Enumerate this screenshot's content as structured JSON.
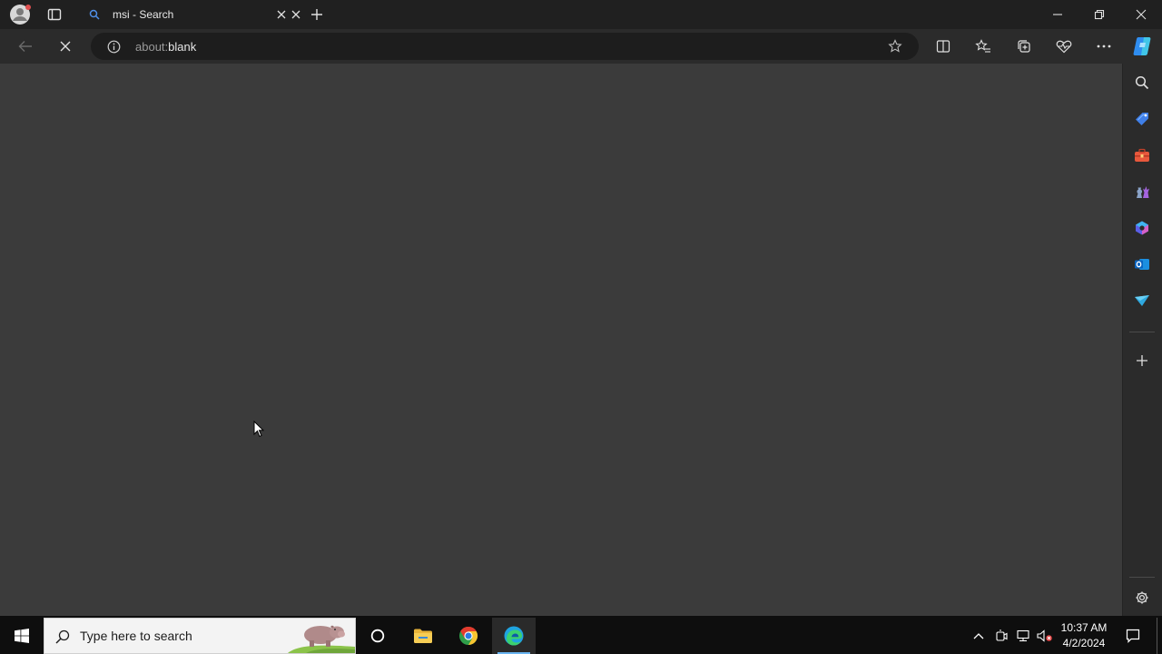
{
  "browser": {
    "tab": {
      "title": "msi - Search"
    },
    "address": {
      "prefix": "about:",
      "page": "blank"
    }
  },
  "taskbar": {
    "search_placeholder": "Type here to search",
    "clock": {
      "time": "10:37 AM",
      "date": "4/2/2024"
    }
  },
  "colors": {
    "content_bg": "#3b3b3b",
    "titlebar_bg": "#202020",
    "toolbar_bg": "#2b2b2b",
    "taskbar_bg": "#0e0e0e",
    "edge_blue": "#1fa3e0"
  }
}
